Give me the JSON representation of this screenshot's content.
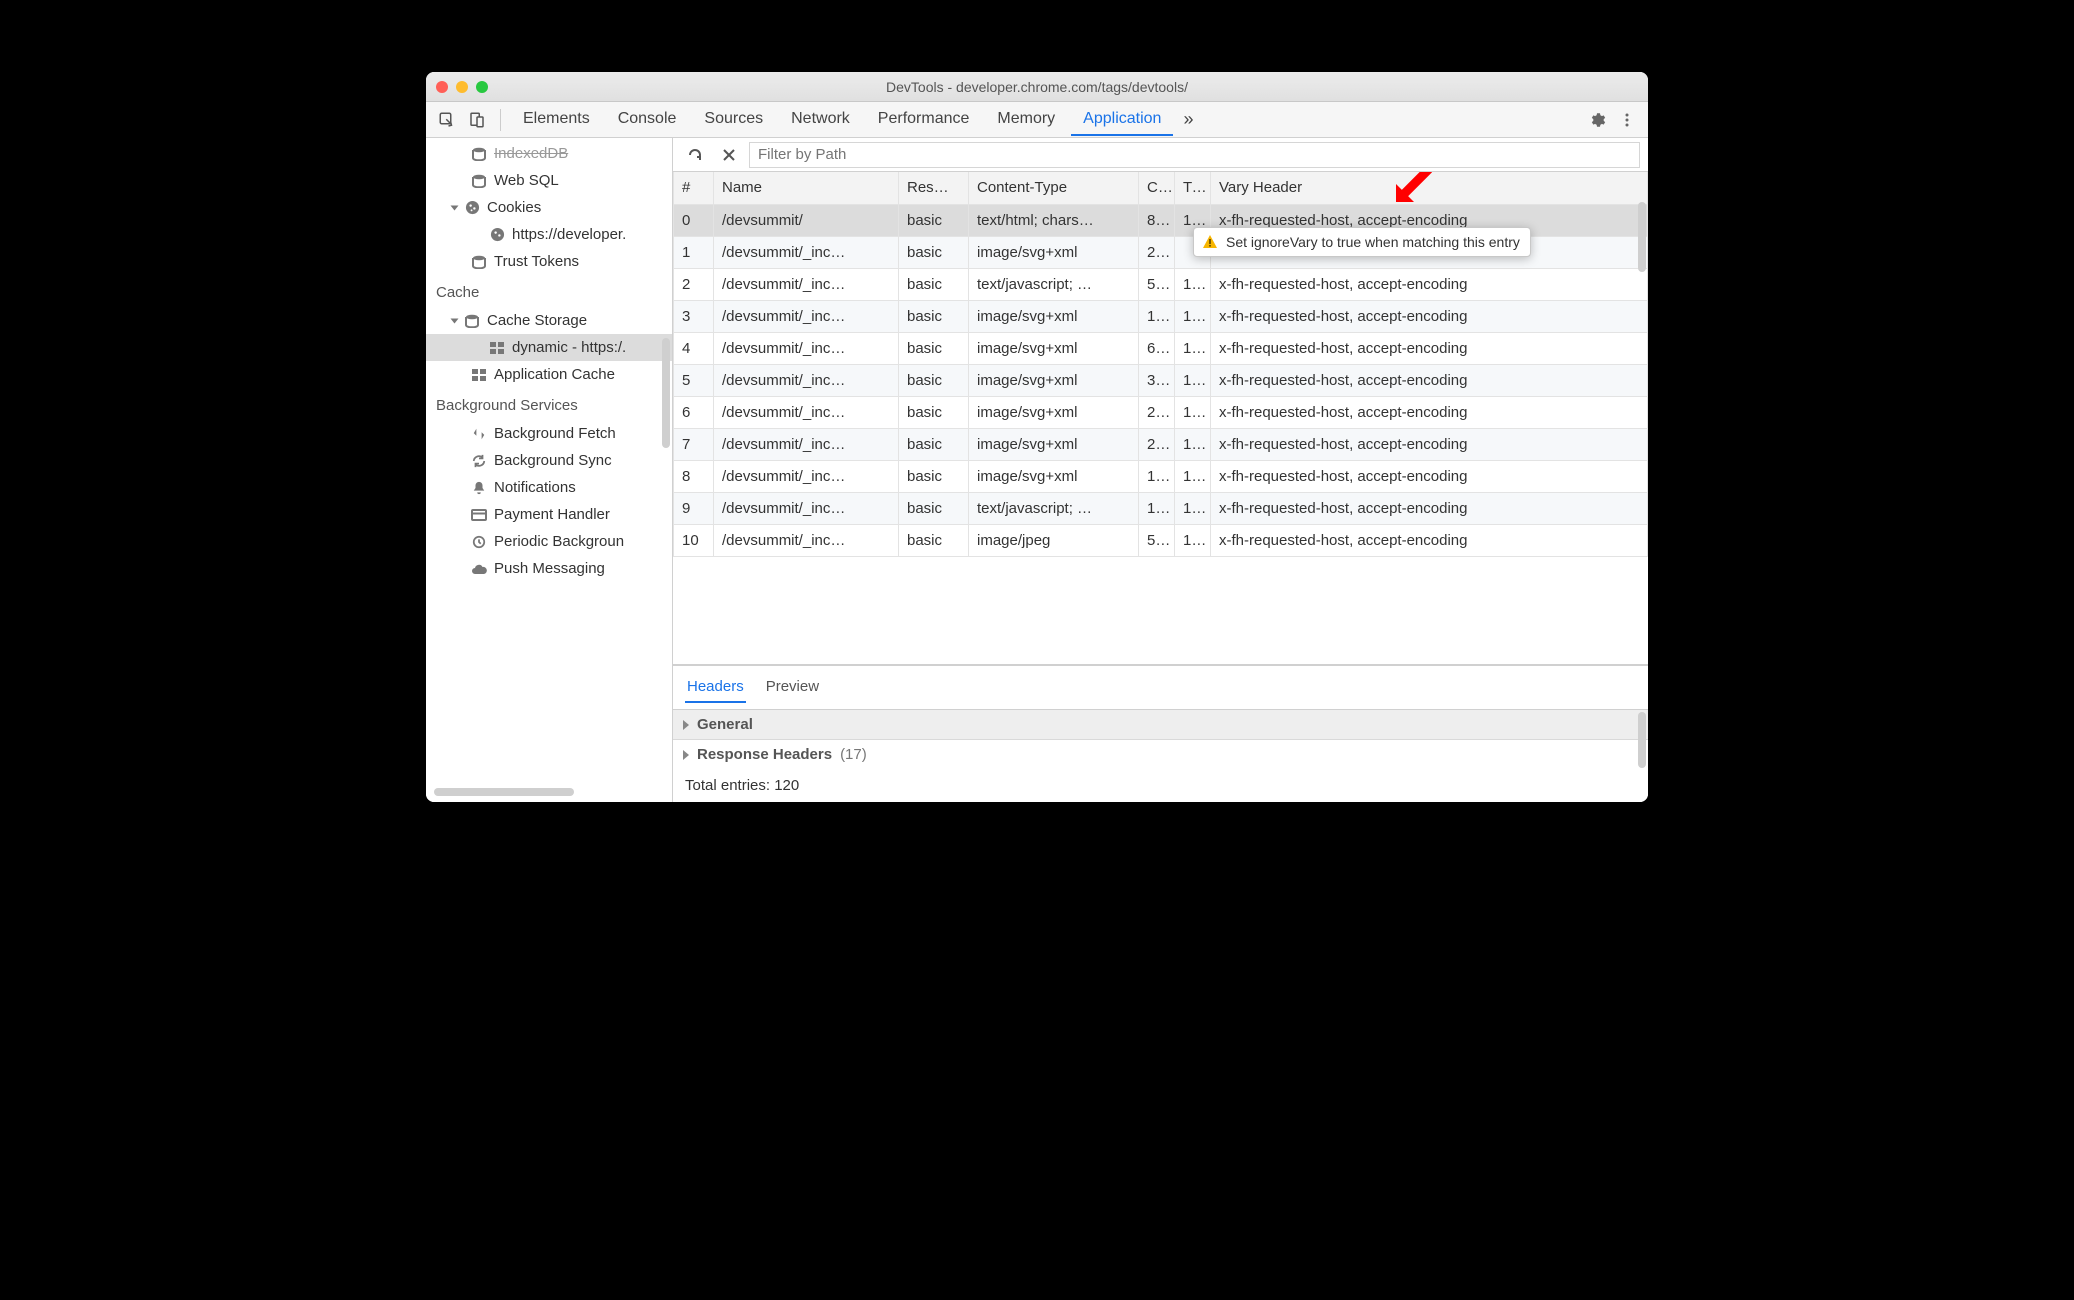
{
  "window_title": "DevTools - developer.chrome.com/tags/devtools/",
  "tabs": [
    "Elements",
    "Console",
    "Sources",
    "Network",
    "Performance",
    "Memory",
    "Application"
  ],
  "active_tab_index": 6,
  "sidebar": {
    "storage_items": {
      "indexeddb": "IndexedDB",
      "websql": "Web SQL",
      "cookies": "Cookies",
      "cookies_child": "https://developer.",
      "trust_tokens": "Trust Tokens"
    },
    "cache_title": "Cache",
    "cache_storage": "Cache Storage",
    "cache_child": "dynamic - https:/.",
    "app_cache": "Application Cache",
    "bg_title": "Background Services",
    "bg": {
      "fetch": "Background Fetch",
      "sync": "Background Sync",
      "notifications": "Notifications",
      "payment": "Payment Handler",
      "periodic": "Periodic Backgroun",
      "push": "Push Messaging"
    }
  },
  "filter_placeholder": "Filter by Path",
  "columns": {
    "idx": "#",
    "name": "Name",
    "response": "Res…",
    "content_type": "Content-Type",
    "content_length": "C..",
    "time_cached": "Ti…",
    "vary": "Vary Header"
  },
  "rows": [
    {
      "idx": "0",
      "name": "/devsummit/",
      "response": "basic",
      "ct": "text/html; chars…",
      "cl": "8…",
      "tc": "1…",
      "vary": "x-fh-requested-host, accept-encoding"
    },
    {
      "idx": "1",
      "name": "/devsummit/_inc…",
      "response": "basic",
      "ct": "image/svg+xml",
      "cl": "2…",
      "tc": "",
      "vary": ""
    },
    {
      "idx": "2",
      "name": "/devsummit/_inc…",
      "response": "basic",
      "ct": "text/javascript; …",
      "cl": "5…",
      "tc": "1…",
      "vary": "x-fh-requested-host, accept-encoding"
    },
    {
      "idx": "3",
      "name": "/devsummit/_inc…",
      "response": "basic",
      "ct": "image/svg+xml",
      "cl": "1…",
      "tc": "1…",
      "vary": "x-fh-requested-host, accept-encoding"
    },
    {
      "idx": "4",
      "name": "/devsummit/_inc…",
      "response": "basic",
      "ct": "image/svg+xml",
      "cl": "6…",
      "tc": "1…",
      "vary": "x-fh-requested-host, accept-encoding"
    },
    {
      "idx": "5",
      "name": "/devsummit/_inc…",
      "response": "basic",
      "ct": "image/svg+xml",
      "cl": "3…",
      "tc": "1…",
      "vary": "x-fh-requested-host, accept-encoding"
    },
    {
      "idx": "6",
      "name": "/devsummit/_inc…",
      "response": "basic",
      "ct": "image/svg+xml",
      "cl": "2…",
      "tc": "1…",
      "vary": "x-fh-requested-host, accept-encoding"
    },
    {
      "idx": "7",
      "name": "/devsummit/_inc…",
      "response": "basic",
      "ct": "image/svg+xml",
      "cl": "2…",
      "tc": "1…",
      "vary": "x-fh-requested-host, accept-encoding"
    },
    {
      "idx": "8",
      "name": "/devsummit/_inc…",
      "response": "basic",
      "ct": "image/svg+xml",
      "cl": "1…",
      "tc": "1…",
      "vary": "x-fh-requested-host, accept-encoding"
    },
    {
      "idx": "9",
      "name": "/devsummit/_inc…",
      "response": "basic",
      "ct": "text/javascript; …",
      "cl": "1…",
      "tc": "1…",
      "vary": "x-fh-requested-host, accept-encoding"
    },
    {
      "idx": "10",
      "name": "/devsummit/_inc…",
      "response": "basic",
      "ct": "image/jpeg",
      "cl": "5…",
      "tc": "1…",
      "vary": "x-fh-requested-host, accept-encoding"
    }
  ],
  "tooltip_text": "Set ignoreVary to true when matching this entry",
  "details": {
    "tabs": [
      "Headers",
      "Preview"
    ],
    "active": 0,
    "general": "General",
    "response_headers": "Response Headers",
    "response_headers_count": "(17)",
    "total": "Total entries: 120"
  }
}
